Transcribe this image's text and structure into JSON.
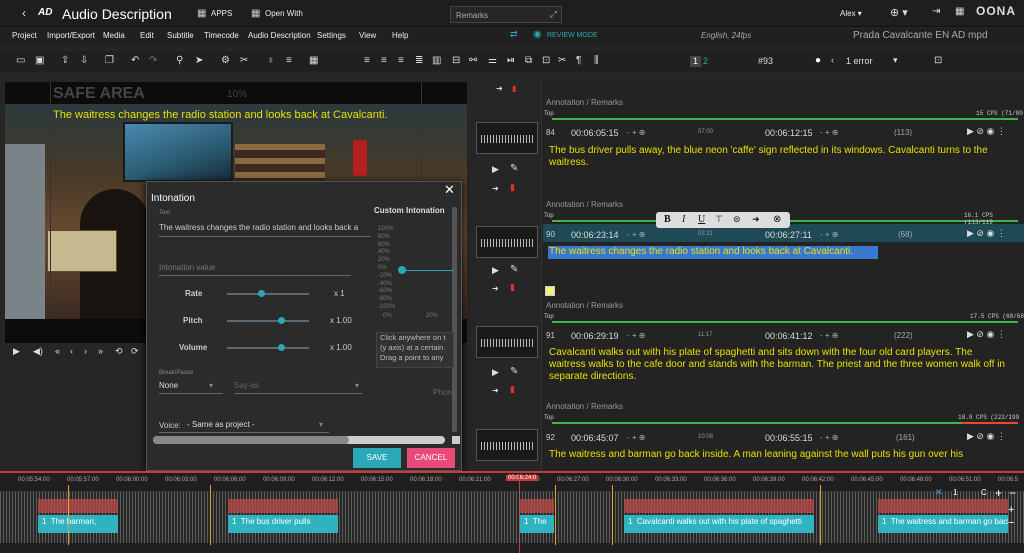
{
  "app": {
    "logo": "AD",
    "title": "Audio Description",
    "apps": "APPS",
    "open_with": "Open With",
    "remarks": "Remarks",
    "user": "Alex",
    "brand": "OONA"
  },
  "menu": [
    "Project",
    "Import/Export",
    "Media",
    "Edit",
    "Subtitle",
    "Timecode",
    "Audio Description",
    "Settings",
    "View",
    "Help"
  ],
  "review_mode": "REVIEW MODE",
  "language": "English, 24fps",
  "project_name": "Prada Cavalcante EN AD mpd",
  "toolbar": {
    "page1": "1",
    "page2": "2",
    "current": "#93",
    "errors": "1 error"
  },
  "video": {
    "safe_area": "SAFE AREA",
    "pct": "10%",
    "caption": "The waitress changes the radio station and looks back at Cavalcanti."
  },
  "dialog": {
    "title": "Intonation",
    "text_label": "Text",
    "text_value": "The waitress changes the radio station and looks back a",
    "custom_intonation": "Custom Intonation",
    "intonation_placeholder": "Intonation value",
    "rate_label": "Rate",
    "rate_value": "x 1",
    "rate": 0.42,
    "pitch_label": "Pitch",
    "pitch_value": "x 1.00",
    "pitch": 0.66,
    "volume_label": "Volume",
    "volume_value": "x 1.00",
    "volume": 0.66,
    "break_label": "Break/Pause",
    "break_value": "None",
    "sayas_placeholder": "Say-as",
    "phon_placeholder": "Phon",
    "voice_label": "Voice:",
    "voice_value": "- Same as project -",
    "yaxis": [
      "100%",
      "80%",
      "60%",
      "40%",
      "20%",
      "0%",
      "-20%",
      "-40%",
      "-60%",
      "-80%",
      "-100%"
    ],
    "xaxis": [
      "0%",
      "20%"
    ],
    "help": [
      "Click anywhere on t",
      "(y axis) at a certain",
      "Drag a point to any"
    ],
    "save": "SAVE",
    "cancel": "CANCEL"
  },
  "format_bar": [
    "B",
    "I",
    "U"
  ],
  "rows": [
    {
      "ann": "Annotation",
      "sep": "/",
      "remarks": "Remarks",
      "top": "Top",
      "cps": "15 CPS (71/80",
      "num": "84",
      "tc_in": "00:06:05:15",
      "dur": "07:00",
      "tc_out": "00:06:12:15",
      "count": "(113)",
      "text": "The bus driver pulls away, the blue neon 'caffe' sign reflected in its windows. Cavalcanti turns to the waitress."
    },
    {
      "ann": "Annotation",
      "sep": "/",
      "remarks": "Remarks",
      "top": "Top",
      "cps": "16.1 CPS (113/119",
      "num": "90",
      "tc_in": "00:06:23:14",
      "dur": "03:21",
      "tc_out": "00:06:27:11",
      "count": "(68)",
      "text": "The waitress changes the radio station and looks back at Cavalcanti."
    },
    {
      "ann": "Annotation",
      "sep": "/",
      "remarks": "Remarks",
      "top": "Top",
      "cps": "17.5 CPS (68/68",
      "num": "91",
      "tc_in": "00:06:29:19",
      "dur": "11:17",
      "tc_out": "00:06:41:12",
      "count": "(222)",
      "text": "Cavalcanti walks out with his plate of spaghetti and sits down with the four old card players. The waitress walks to the cafe door and stands with the barman. The priest and the three women walk off in separate directions."
    },
    {
      "ann": "Annotation",
      "sep": "/",
      "remarks": "Remarks",
      "top": "Top",
      "cps": "18.9 CPS (222/199",
      "num": "92",
      "tc_in": "00:06:45:07",
      "dur": "10:08",
      "tc_out": "00:06:55:15",
      "count": "(161)",
      "text": "The waitress and barman go back inside. A man leaning against the wall puts his gun over his"
    }
  ],
  "timeline": {
    "ticks": [
      "00:05:54:00",
      "00:05:57:00",
      "00:06:00:00",
      "00:06:03:00",
      "00:06:06:00",
      "00:06:09:00",
      "00:06:12:00",
      "00:06:15:00",
      "00:06:18:00",
      "00:06:21:00",
      "00:06:24:00",
      "00:06:27:00",
      "00:06:30:00",
      "00:06:33:00",
      "00:06:36:00",
      "00:06:39:00",
      "00:06:42:00",
      "00:06:45:00",
      "00:06:48:00",
      "00:06:51:00",
      "00:06:5"
    ],
    "playhead": "00:06:24:0",
    "segments": [
      {
        "n": "1",
        "text": "The barman,"
      },
      {
        "n": "1",
        "text": "The bus driver pulls"
      },
      {
        "n": "1",
        "text": "The"
      },
      {
        "n": "1",
        "text": "Cavalcanti walks out with his plate of spaghetti"
      },
      {
        "n": "1",
        "text": "The waitress and barman go back"
      }
    ],
    "zoom": [
      "1",
      "C"
    ]
  }
}
